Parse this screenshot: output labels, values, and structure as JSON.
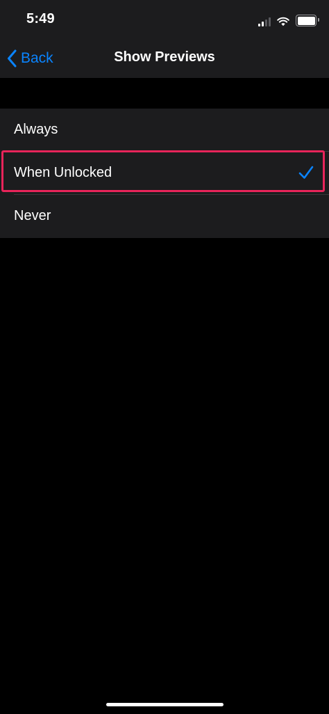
{
  "status_bar": {
    "time": "5:49",
    "icons": [
      "signal-icon",
      "wifi-icon",
      "battery-icon"
    ]
  },
  "nav": {
    "back_label": "Back",
    "title": "Show Previews"
  },
  "options": [
    {
      "label": "Always",
      "selected": false
    },
    {
      "label": "When Unlocked",
      "selected": true
    },
    {
      "label": "Never",
      "selected": false
    }
  ],
  "colors": {
    "accent": "#0a84ff",
    "highlight": "#e8245a",
    "background": "#000000",
    "cell_background": "#1c1c1e"
  }
}
